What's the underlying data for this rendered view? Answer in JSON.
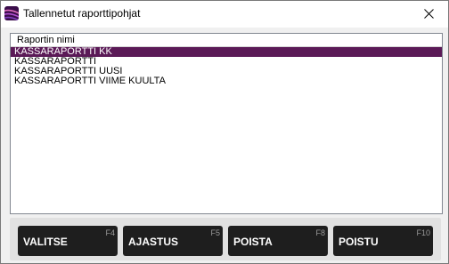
{
  "window": {
    "title": "Tallennetut raporttipohjat",
    "icon": "app-logo-icon",
    "close_icon": "close-icon"
  },
  "list": {
    "header": "Raportin nimi",
    "items": [
      "KASSARAPORTTI KK",
      "KASSARAPORTTI",
      "KASSARAPORTTI UUSI",
      "KASSARAPORTTI VIIME KUULTA"
    ],
    "selected_index": 0
  },
  "buttons": [
    {
      "label": "VALITSE",
      "key": "F4"
    },
    {
      "label": "AJASTUS",
      "key": "F5"
    },
    {
      "label": "POISTA",
      "key": "F8"
    },
    {
      "label": "POISTU",
      "key": "F10"
    }
  ],
  "colors": {
    "selection": "#5b1a57",
    "button_bg": "#1e1e1e",
    "button_text": "#ffffff",
    "key_text": "#9a9a9a"
  }
}
